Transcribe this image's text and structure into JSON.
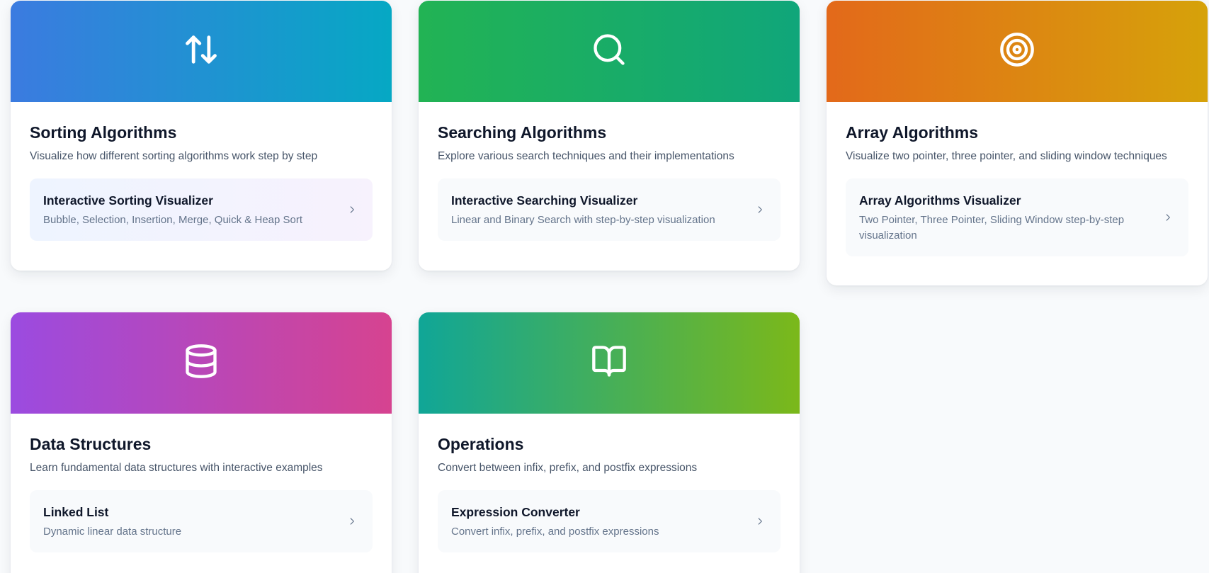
{
  "cards": [
    {
      "icon": "arrows-up-down-icon",
      "title": "Sorting Algorithms",
      "description": "Visualize how different sorting algorithms work step by step",
      "item": {
        "title": "Interactive Sorting Visualizer",
        "subtitle": "Bubble, Selection, Insertion, Merge, Quick & Heap Sort"
      }
    },
    {
      "icon": "search-icon",
      "title": "Searching Algorithms",
      "description": "Explore various search techniques and their implementations",
      "item": {
        "title": "Interactive Searching Visualizer",
        "subtitle": "Linear and Binary Search with step-by-step visualization"
      }
    },
    {
      "icon": "target-icon",
      "title": "Array Algorithms",
      "description": "Visualize two pointer, three pointer, and sliding window techniques",
      "item": {
        "title": "Array Algorithms Visualizer",
        "subtitle": "Two Pointer, Three Pointer, Sliding Window step-by-step visualization"
      }
    },
    {
      "icon": "database-icon",
      "title": "Data Structures",
      "description": "Learn fundamental data structures with interactive examples",
      "item": {
        "title": "Linked List",
        "subtitle": "Dynamic linear data structure"
      }
    },
    {
      "icon": "book-open-icon",
      "title": "Operations",
      "description": "Convert between infix, prefix, and postfix expressions",
      "item": {
        "title": "Expression Converter",
        "subtitle": "Convert infix, prefix, and postfix expressions"
      }
    }
  ],
  "colors": {
    "sorting_gradient": [
      "#3b7be0",
      "#06a8c4"
    ],
    "searching_gradient": [
      "#22b354",
      "#10a67a"
    ],
    "array_gradient": [
      "#e3691a",
      "#d6a20a"
    ],
    "data_structures_gradient": [
      "#9b4be0",
      "#d64390"
    ],
    "operations_gradient": [
      "#10a697",
      "#7bb81a"
    ]
  }
}
